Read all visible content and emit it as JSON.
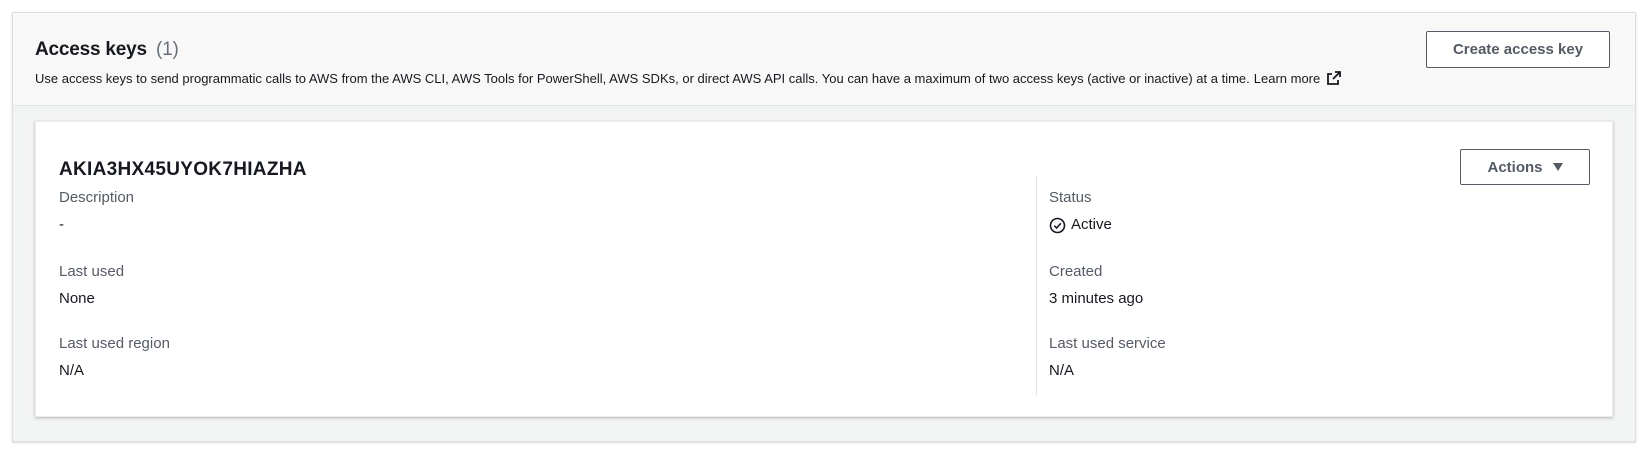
{
  "section": {
    "title": "Access keys",
    "count": "(1)",
    "description": "Use access keys to send programmatic calls to AWS from the AWS CLI, AWS Tools for PowerShell, AWS SDKs, or direct AWS API calls. You can have a maximum of two access keys (active or inactive) at a time.",
    "learn_more": "Learn more",
    "create_button": "Create access key"
  },
  "key": {
    "id": "AKIA3HX45UYOK7HIAZHA",
    "actions_button": "Actions",
    "description_label": "Description",
    "description_value": "-",
    "last_used_label": "Last used",
    "last_used_value": "None",
    "last_used_region_label": "Last used region",
    "last_used_region_value": "N/A",
    "status_label": "Status",
    "status_value": "Active",
    "created_label": "Created",
    "created_value": "3 minutes ago",
    "last_used_service_label": "Last used service",
    "last_used_service_value": "N/A"
  },
  "icons": {
    "external_link": "external-link-icon",
    "status": "check-circle-icon",
    "actions_caret": "caret-down-icon"
  },
  "colors": {
    "text": "#16191f",
    "muted": "#687078",
    "button_border": "#545b64",
    "panel_bg": "#f2f3f3"
  }
}
